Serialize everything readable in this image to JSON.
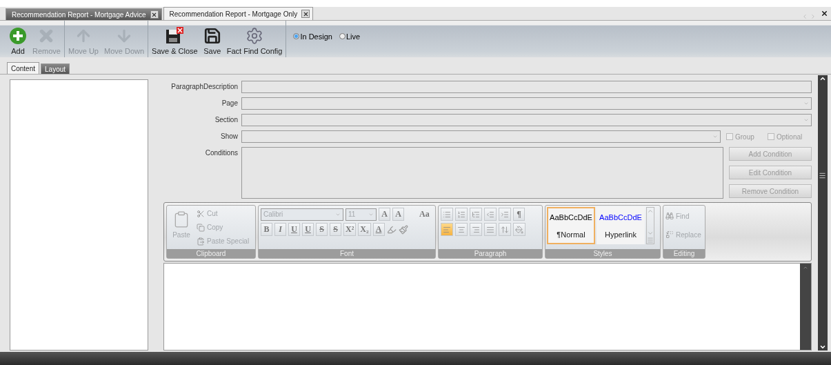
{
  "doc_tabs": [
    {
      "label": "Recommendation Report - Mortgage Advice",
      "selected": false
    },
    {
      "label": "Recommendation Report - Mortgage Only",
      "selected": true
    }
  ],
  "toolbar": {
    "groups": [
      [
        {
          "label": "Add",
          "kind": "add",
          "disabled": false
        },
        {
          "label": "Remove",
          "kind": "remove",
          "disabled": true
        }
      ],
      [
        {
          "label": "Move Up",
          "kind": "up",
          "disabled": true
        },
        {
          "label": "Move Down",
          "kind": "down",
          "disabled": true
        }
      ],
      [
        {
          "label": "Save & Close",
          "kind": "save-close",
          "disabled": false
        },
        {
          "label": "Save",
          "kind": "save",
          "disabled": false
        },
        {
          "label": "Fact Find Config",
          "kind": "gears",
          "disabled": false
        }
      ]
    ],
    "modes": [
      {
        "label": "In Design",
        "selected": true
      },
      {
        "label": "Live",
        "selected": false
      }
    ]
  },
  "view_tabs": [
    {
      "label": "Content",
      "selected": true
    },
    {
      "label": "Layout",
      "selected": false
    }
  ],
  "form": {
    "fields": [
      {
        "label": "ParagraphDescription",
        "kind": "text"
      },
      {
        "label": "Page",
        "kind": "dropdown"
      },
      {
        "label": "Section",
        "kind": "dropdown"
      },
      {
        "label": "Show",
        "kind": "dropdown"
      }
    ],
    "options": [
      {
        "label": "Group",
        "checked": false
      },
      {
        "label": "Optional",
        "checked": false
      }
    ],
    "conditions_label": "Conditions",
    "condition_buttons": [
      "Add Condition",
      "Edit Condition",
      "Remove Condition"
    ]
  },
  "ribbon": {
    "clipboard": {
      "title": "Clipboard",
      "paste": "Paste",
      "items": [
        {
          "label": "Cut",
          "kind": "cut"
        },
        {
          "label": "Copy",
          "kind": "copy"
        },
        {
          "label": "Paste Special",
          "kind": "paste-special"
        }
      ]
    },
    "font": {
      "title": "Font",
      "font_name": "Calibri",
      "font_size": "11",
      "grow_shrink": [
        "A",
        "A"
      ],
      "case_button": "Aa",
      "format_buttons": [
        "B",
        "I",
        "U",
        "U",
        "S",
        "S",
        "X²",
        "X₂"
      ],
      "color_button": "A"
    },
    "paragraph": {
      "title": "Paragraph",
      "pilcrow": "¶",
      "alignments": [
        {
          "kind": "left",
          "selected": true
        },
        {
          "kind": "center",
          "selected": false
        },
        {
          "kind": "right",
          "selected": false
        },
        {
          "kind": "justify",
          "selected": false
        }
      ]
    },
    "styles": {
      "title": "Styles",
      "items": [
        {
          "preview": "AaBbCcDdE",
          "mark": "¶",
          "name": "Normal",
          "selected": true,
          "color": "#000000"
        },
        {
          "preview": "AaBbCcDdE",
          "name": "Hyperlink",
          "selected": false,
          "color": "#0000ff"
        }
      ]
    },
    "editing": {
      "title": "Editing",
      "items": [
        {
          "label": "Find",
          "kind": "find"
        },
        {
          "label": "Replace",
          "kind": "replace"
        }
      ]
    }
  }
}
